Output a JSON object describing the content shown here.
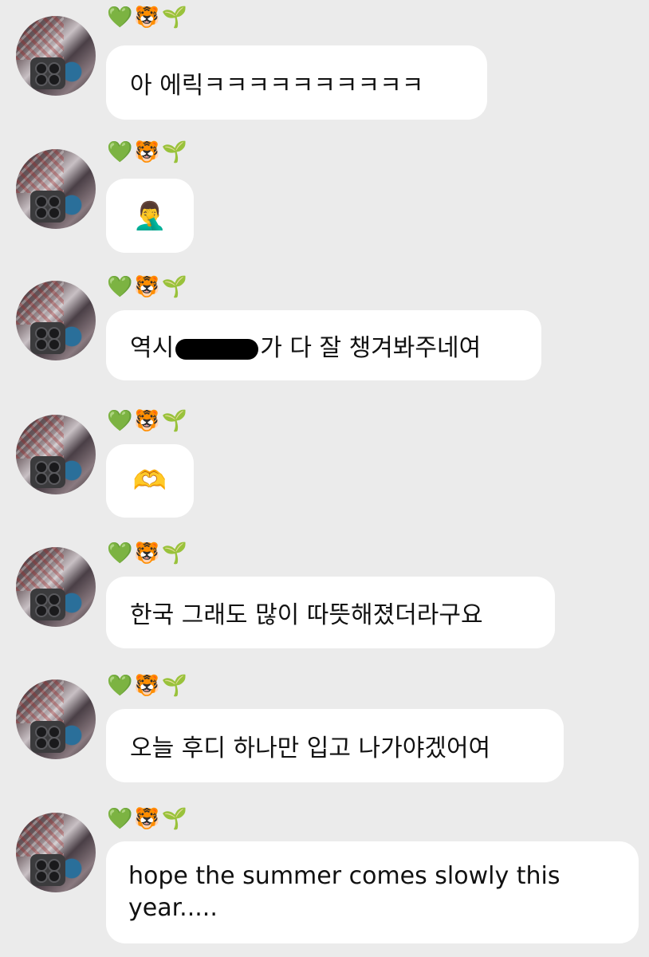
{
  "sender": {
    "badge": "💚🐯🌱"
  },
  "messages": [
    {
      "text": "아 에릭ㅋㅋㅋㅋㅋㅋㅋㅋㅋㅋ"
    },
    {
      "text": "🤦‍♂️"
    },
    {
      "text_before": "역시",
      "redacted": true,
      "text_after": "가 다 잘 챙겨봐주네여"
    },
    {
      "text": "🫶"
    },
    {
      "text": "한국 그래도 많이 따뜻해졌더라구요"
    },
    {
      "text": "오늘 후디 하나만 입고 나가야겠어여"
    },
    {
      "text": "hope the summer comes slowly this year....."
    }
  ]
}
